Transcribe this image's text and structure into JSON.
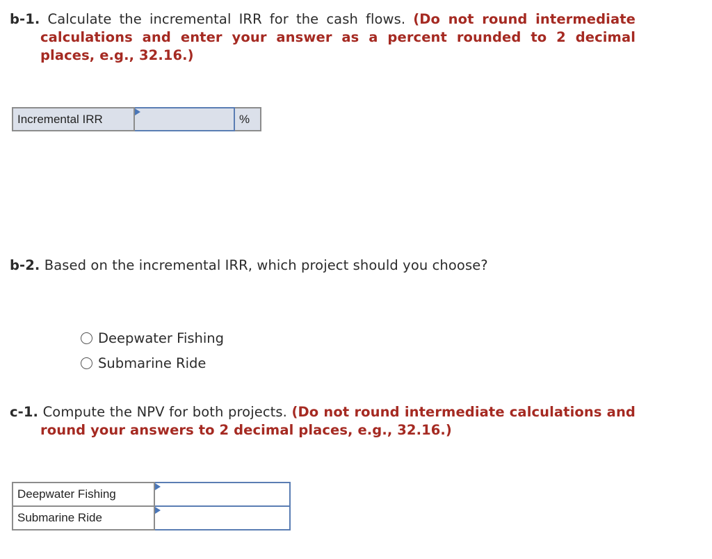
{
  "b1": {
    "number": "b-1.",
    "text": "Calculate the incremental IRR for the cash flows.",
    "instruction": "(Do not round intermediate calculations and enter your answer as a percent rounded to 2 decimal places, e.g., 32.16.)",
    "table": {
      "label": "Incremental IRR",
      "value": "",
      "unit": "%"
    }
  },
  "b2": {
    "number": "b-2.",
    "text": "Based on the incremental IRR, which project should you choose?",
    "options": [
      {
        "label": "Deepwater Fishing",
        "selected": false
      },
      {
        "label": "Submarine Ride",
        "selected": false
      }
    ]
  },
  "c1": {
    "number": "c-1.",
    "text": "Compute the NPV for both projects.",
    "instruction": "(Do not round intermediate calculations and round your answers to 2 decimal places, e.g., 32.16.)",
    "rows": [
      {
        "label": "Deepwater Fishing",
        "value": ""
      },
      {
        "label": "Submarine Ride",
        "value": ""
      }
    ]
  },
  "colors": {
    "instruction_red": "#a52a22",
    "input_border_blue": "#5a7db3",
    "input_fill": "#dbe0ea"
  }
}
